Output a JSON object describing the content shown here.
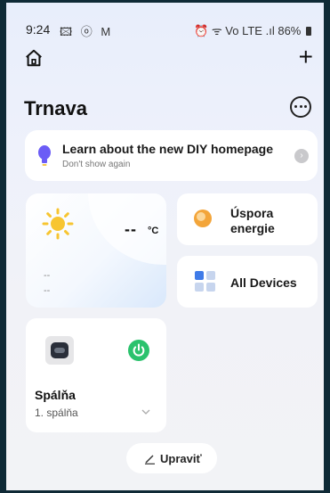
{
  "status_bar": {
    "time": "9:24",
    "left_icons": "🖾 ⓞ M",
    "right_icons": "⏰ ᯤ Vo LTE .ıl",
    "battery": "86%"
  },
  "header": {
    "home_icon": "home-icon",
    "add_icon": "plus-icon",
    "add_symbol": "+",
    "title": "Trnava",
    "more_icon": "more-circle-icon"
  },
  "banner": {
    "title": "Learn about the new DIY homepage",
    "subtitle": "Don't show again",
    "arrow_symbol": "›",
    "bulb_color": "#6b5cf6"
  },
  "weather": {
    "temperature": "--",
    "unit": "°C",
    "line1": "--",
    "line2": "--",
    "sun_color": "#f7c531"
  },
  "tiles": {
    "energy": {
      "label": "Úspora energie",
      "icon_color": "#f3a53a"
    },
    "devices": {
      "label": "All Devices",
      "icon_color": "#3f7be8"
    }
  },
  "device": {
    "name": "Spálňa",
    "room": "1. spálňa",
    "power_color": "#2bc26d",
    "power_state": "on"
  },
  "edit": {
    "label": "Upraviť"
  }
}
